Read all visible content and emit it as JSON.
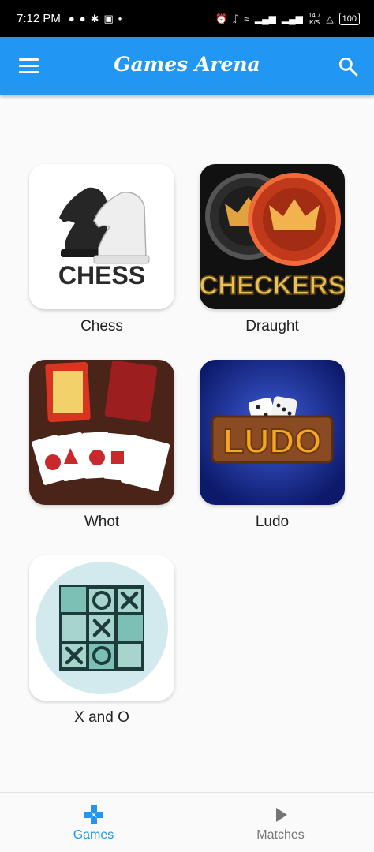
{
  "status_bar": {
    "time": "7:12 PM",
    "speed": "14.7",
    "speed_unit": "K/S",
    "battery": "100"
  },
  "app_bar": {
    "title": "Games Arena"
  },
  "games": [
    {
      "label": "Chess",
      "logo_text": "CHESS"
    },
    {
      "label": "Draught",
      "logo_text": "CHECKERS"
    },
    {
      "label": "Whot"
    },
    {
      "label": "Ludo",
      "logo_text": "LUDO"
    },
    {
      "label": "X and O"
    }
  ],
  "bottom_nav": {
    "items": [
      {
        "label": "Games",
        "active": true
      },
      {
        "label": "Matches",
        "active": false
      }
    ]
  },
  "colors": {
    "primary": "#2196f3",
    "nav_active": "#2196f3",
    "nav_inactive": "#757575"
  }
}
